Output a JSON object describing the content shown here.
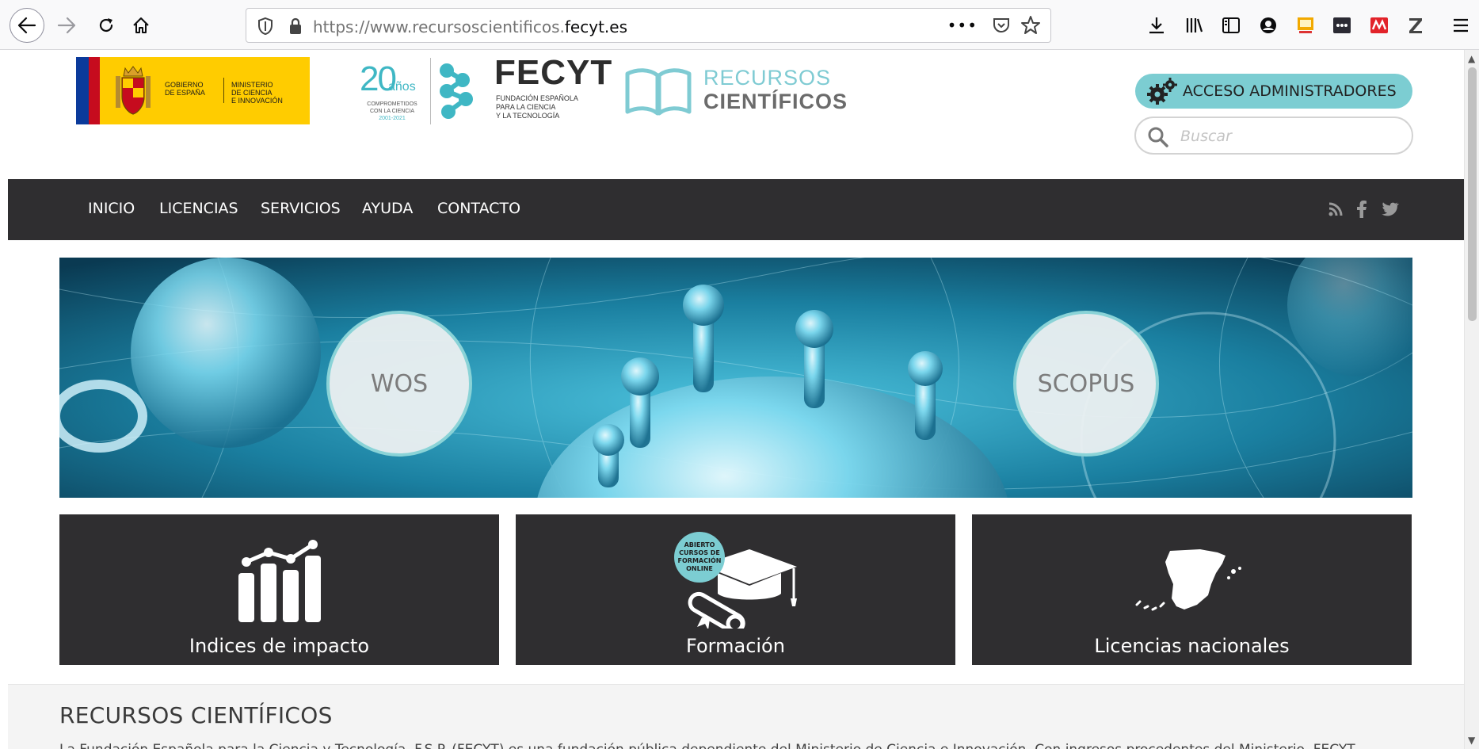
{
  "browser": {
    "url_prefix": "https://www.recursoscientificos.",
    "url_domain": "fecyt.es",
    "more_label": "•••"
  },
  "header": {
    "gov_logo": {
      "line1": "GOBIERNO",
      "line2": "DE ESPAÑA",
      "ministry1": "MINISTERIO",
      "ministry2": "DE CIENCIA",
      "ministry3": "E INNOVACIÓN"
    },
    "anniversary_logo": {
      "number": "20",
      "word": "años",
      "line1": "COMPROMETIDOS",
      "line2": "CON LA CIENCIA",
      "years": "2001-2021"
    },
    "fecyt_logo": {
      "name": "FECYT",
      "sub1": "FUNDACIÓN ESPAÑOLA",
      "sub2": "PARA LA CIENCIA",
      "sub3": "Y LA TECNOLOGÍA"
    },
    "site_logo": {
      "line1": "RECURSOS",
      "line2": "CIENTÍFICOS"
    },
    "admin_button": "ACCESO ADMINISTRADORES",
    "search_placeholder": "Buscar"
  },
  "nav": {
    "items": [
      "INICIO",
      "LICENCIAS",
      "SERVICIOS",
      "AYUDA",
      "CONTACTO"
    ],
    "social": [
      "rss-icon",
      "facebook-icon",
      "twitter-icon"
    ]
  },
  "hero": {
    "left_circle": "WOS",
    "right_circle": "SCOPUS"
  },
  "tiles": [
    {
      "label": "Indices de impacto",
      "icon": "bar-chart-icon"
    },
    {
      "label": "Formación",
      "icon": "graduation-cap-icon",
      "badge": [
        "ABIERTO",
        "CURSOS DE",
        "FORMACIÓN",
        "ONLINE"
      ]
    },
    {
      "label": "Licencias nacionales",
      "icon": "spain-map-icon"
    }
  ],
  "section": {
    "title": "RECURSOS CIENTÍFICOS",
    "text": "La Fundación Española para la Ciencia y Tecnología, F.S.P. (FECYT) es una fundación pública dependiente del Ministerio de Ciencia e Innovación. Con ingresos procedentes del Ministerio, FECYT"
  },
  "colors": {
    "accent": "#7ccdd2",
    "dark": "#2f2e30",
    "nav_text": "#ffffff"
  }
}
